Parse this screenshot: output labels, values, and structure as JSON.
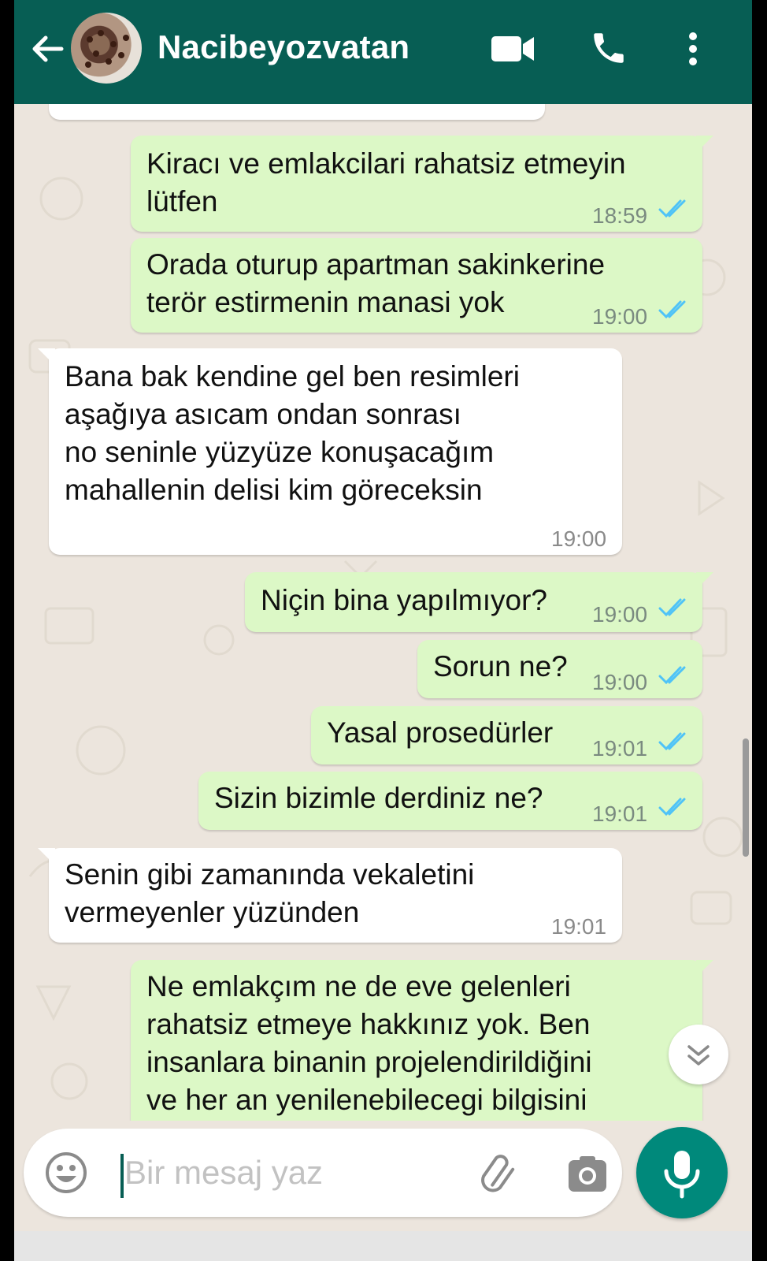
{
  "header": {
    "contact_name": "Nacibeyozvatan",
    "background": "#075E54"
  },
  "messages": [
    {
      "direction": "out",
      "text": "Kiracı ve emlakcilari rahatsiz etmeyin\nlütfen",
      "time": "18:59",
      "status": "read"
    },
    {
      "direction": "out",
      "text": "Orada oturup apartman sakinkerine\nterör estirmenin manasi yok",
      "time": "19:00",
      "status": "read"
    },
    {
      "direction": "in",
      "text": "Bana bak kendine gel ben resimleri\naşağıya asıcam ondan sonrası\nno seninle yüzyüze konuşacağım\nmahallenin delisi kim göreceksin",
      "time": "19:00"
    },
    {
      "direction": "out",
      "text": "Niçin bina yapılmıyor?",
      "time": "19:00",
      "status": "read"
    },
    {
      "direction": "out",
      "text": "Sorun ne?",
      "time": "19:00",
      "status": "read"
    },
    {
      "direction": "out",
      "text": "Yasal prosedürler",
      "time": "19:01",
      "status": "read"
    },
    {
      "direction": "out",
      "text": "Sizin bizimle derdiniz ne?",
      "time": "19:01",
      "status": "read"
    },
    {
      "direction": "in",
      "text": "Senin gibi zamanında vekaletini\nvermeyenler yüzünden",
      "time": "19:01"
    },
    {
      "direction": "out",
      "text": "Ne emlakçım ne de eve gelenleri\nrahatsiz etmeye hakkınız yok. Ben\ninsanlara binanin projelendirildiğini\nve her an yenilenebilecegi bilgisini",
      "time": "",
      "status": ""
    }
  ],
  "composer": {
    "placeholder": "Bir mesaj yaz"
  },
  "colors": {
    "outgoing_bubble": "#DCF8C6",
    "incoming_bubble": "#FFFFFF",
    "chat_background": "#ECE5DD",
    "read_tick": "#4FC3F7",
    "mic_button": "#00897B"
  },
  "icons": {
    "back": "arrow-left-icon",
    "video": "video-camera-icon",
    "call": "phone-icon",
    "menu": "more-vertical-icon",
    "emoji": "emoji-icon",
    "attach": "paperclip-icon",
    "camera": "camera-icon",
    "mic": "microphone-icon",
    "scroll": "double-chevron-down-icon",
    "read": "double-check-icon"
  }
}
